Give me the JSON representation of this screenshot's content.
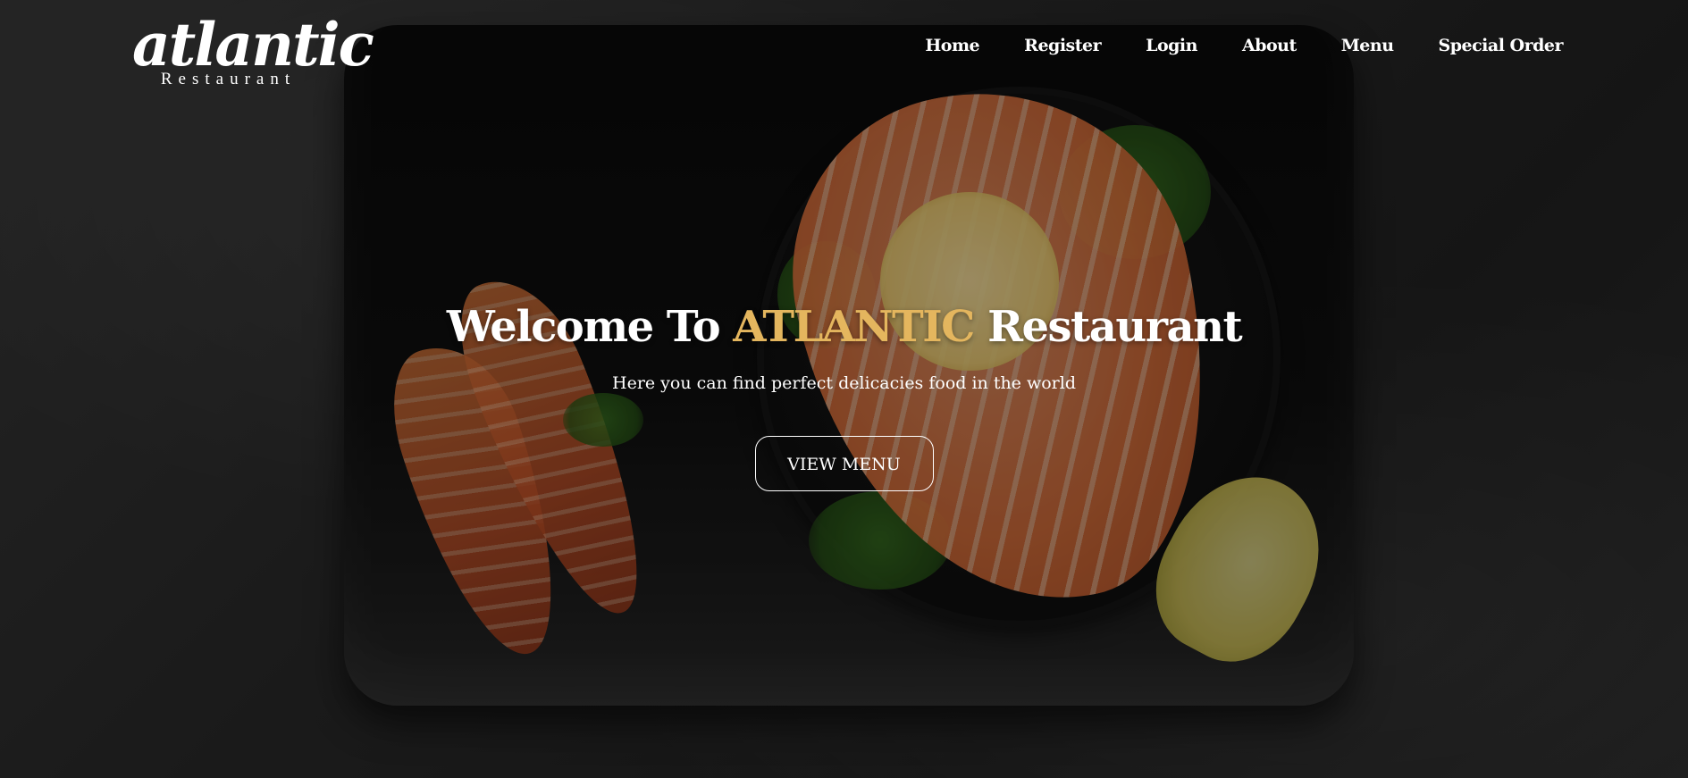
{
  "brand": {
    "logo_main": "atlantic",
    "logo_sub": "Restaurant"
  },
  "nav": {
    "items": [
      {
        "label": "Home"
      },
      {
        "label": "Register"
      },
      {
        "label": "Login"
      },
      {
        "label": "About"
      },
      {
        "label": "Menu"
      },
      {
        "label": "Special Order"
      }
    ]
  },
  "hero": {
    "title_prefix": "Welcome To ",
    "title_brand": "ATLANTIC",
    "title_suffix": " Restaurant",
    "subtitle": "Here you can find perfect delicacies food in the world",
    "button_label": "VIEW MENU"
  },
  "colors": {
    "accent": "#e4b65e",
    "text": "#ffffff",
    "background": "#2a2a2a"
  }
}
